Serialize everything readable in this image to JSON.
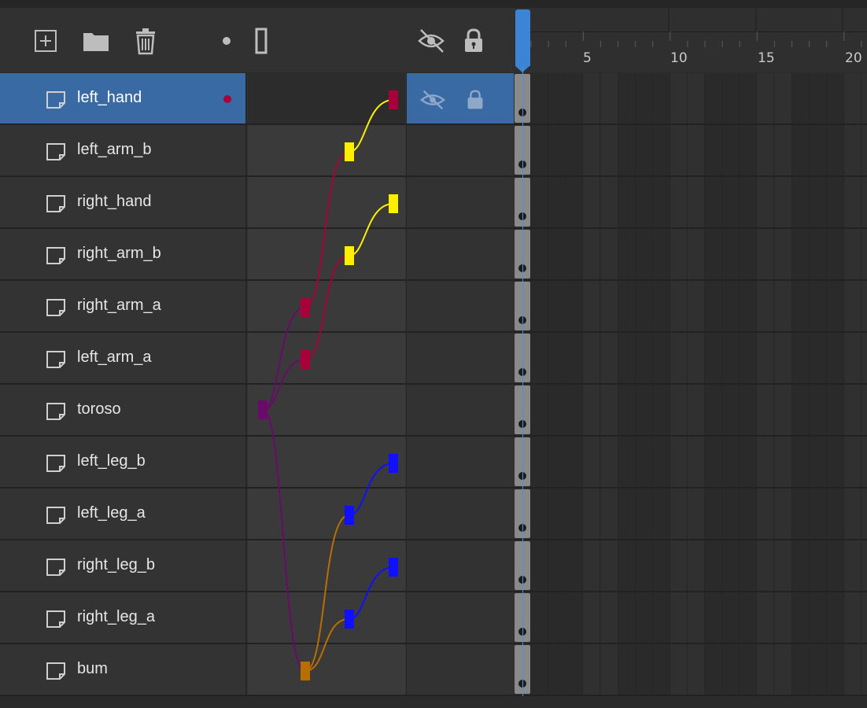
{
  "toolbar": {
    "buttons": [
      {
        "name": "new-layer-button",
        "icon": "plus-square-icon"
      },
      {
        "name": "new-folder-button",
        "icon": "folder-icon"
      },
      {
        "name": "delete-layer-button",
        "icon": "trash-icon"
      },
      {
        "name": "highlight-layers-button",
        "icon": "dot-icon"
      },
      {
        "name": "outline-layers-button",
        "icon": "outline-rect-icon"
      },
      {
        "name": "show-hide-all-button",
        "icon": "eye-slash-icon"
      },
      {
        "name": "lock-all-button",
        "icon": "lock-icon"
      }
    ]
  },
  "ruler": {
    "labels": [
      "5",
      "10",
      "15",
      "20"
    ]
  },
  "layers": [
    {
      "label": "left_hand",
      "selected": true
    },
    {
      "label": "left_arm_b",
      "selected": false
    },
    {
      "label": "right_hand",
      "selected": false
    },
    {
      "label": "right_arm_b",
      "selected": false
    },
    {
      "label": "right_arm_a",
      "selected": false
    },
    {
      "label": "left_arm_a",
      "selected": false
    },
    {
      "label": "toroso",
      "selected": false
    },
    {
      "label": "left_leg_b",
      "selected": false
    },
    {
      "label": "left_leg_a",
      "selected": false
    },
    {
      "label": "right_leg_b",
      "selected": false
    },
    {
      "label": "right_leg_a",
      "selected": false
    },
    {
      "label": "bum",
      "selected": false
    }
  ],
  "colors": {
    "selected": "#3a6aa4",
    "playhead": "#3b84d6",
    "crimson": "#a8003a",
    "yellow": "#ffee00",
    "purple": "#6a0a6a",
    "blue": "#1010ff",
    "orange": "#b86e00"
  }
}
